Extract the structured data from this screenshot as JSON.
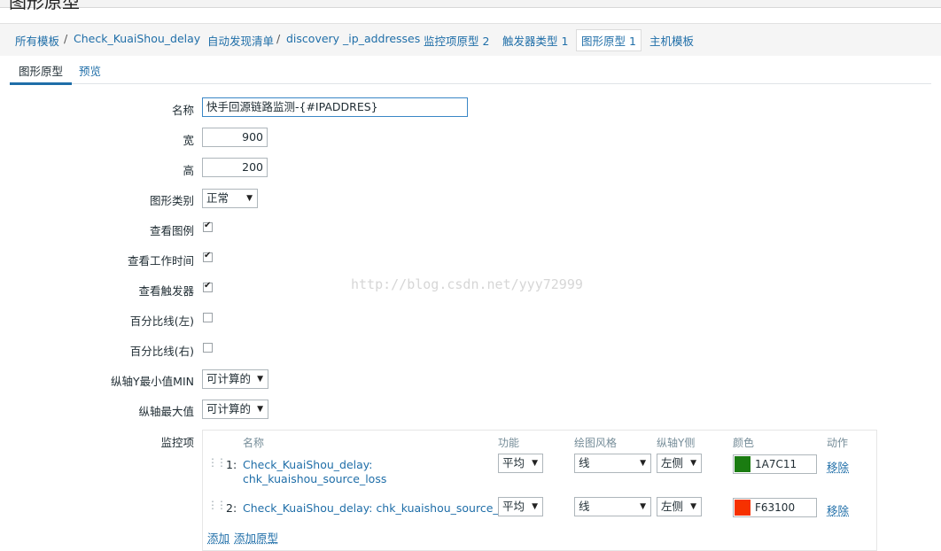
{
  "header": {
    "title": "图形原型"
  },
  "breadcrumb": {
    "all_templates": "所有模板",
    "host": "Check_KuaiShou_delay",
    "discovery_list": "自动发现清单",
    "discovery_rule": "discovery _ip_addresses",
    "item_prototypes": "监控项原型 2",
    "trigger_types": "触发器类型 1",
    "graph_prototypes": "图形原型 1",
    "host_templates": "主机模板",
    "separator": "/"
  },
  "tabs": {
    "graph_prototype": "图形原型",
    "preview": "预览"
  },
  "form": {
    "name_label": "名称",
    "name_value": "快手回源链路监测-{#IPADDRES}",
    "width_label": "宽",
    "width_value": "900",
    "height_label": "高",
    "height_value": "200",
    "graph_type_label": "图形类别",
    "graph_type_value": "正常",
    "show_legend_label": "查看图例",
    "show_legend": true,
    "show_working_time_label": "查看工作时间",
    "show_working_time": true,
    "show_triggers_label": "查看触发器",
    "show_triggers": true,
    "percentile_left_label": "百分比线(左)",
    "percentile_left": false,
    "percentile_right_label": "百分比线(右)",
    "percentile_right": false,
    "ymin_label": "纵轴Y最小值MIN",
    "ymin_value": "可计算的",
    "ymax_label": "纵轴最大值",
    "ymax_value": "可计算的",
    "items_label": "监控项"
  },
  "items_table": {
    "headers": {
      "name": "名称",
      "function": "功能",
      "draw_style": "绘图风格",
      "y_axis": "纵轴Y侧",
      "color": "颜色",
      "action": "动作"
    },
    "rows": [
      {
        "num": "1:",
        "name_line1": "Check_KuaiShou_delay:",
        "name_line2": "chk_kuaishou_source_loss",
        "function": "平均",
        "draw_style": "线",
        "y_axis": "左侧",
        "color": "1A7C11",
        "color_hex": "#1A7C11",
        "action": "移除"
      },
      {
        "num": "2:",
        "name_line1": "Check_KuaiShou_delay: chk_kuaishou_source_rtt",
        "name_line2": "",
        "function": "平均",
        "draw_style": "线",
        "y_axis": "左侧",
        "color": "F63100",
        "color_hex": "#F63100",
        "action": "移除"
      }
    ],
    "add": "添加",
    "add_prototype": "添加原型"
  },
  "watermark": "http://blog.csdn.net/yyy72999"
}
